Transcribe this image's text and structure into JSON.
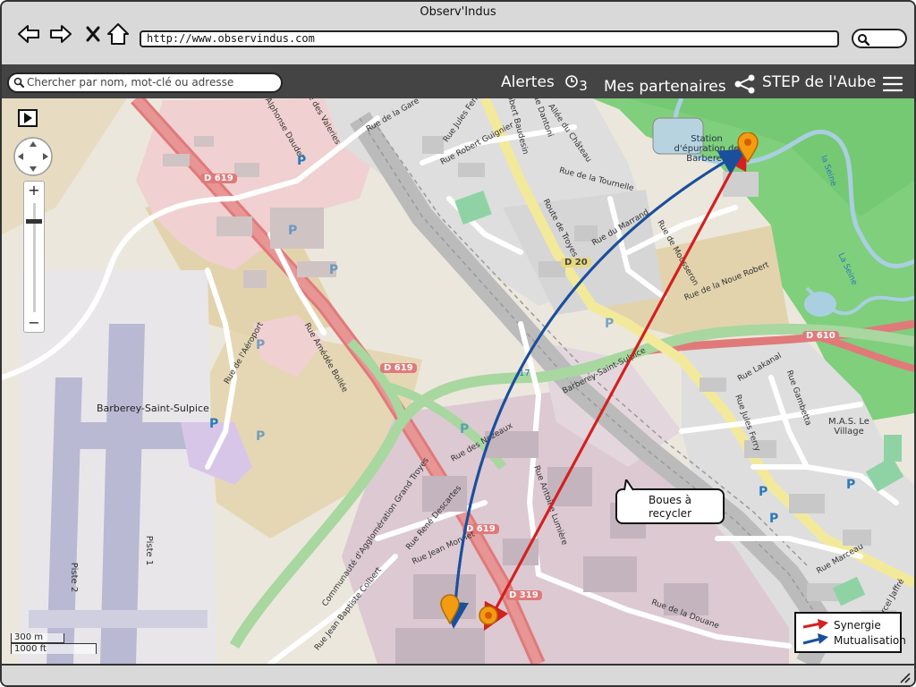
{
  "window": {
    "title": "Observ'Indus"
  },
  "browser": {
    "url": "http://www.observindus.com"
  },
  "appbar": {
    "search_placeholder": "Chercher par nom, mot-clé ou adresse",
    "alerts_label": "Alertes",
    "alerts_count": "3",
    "partners_label": "Mes partenaires",
    "step_label": "STEP de l'Aube"
  },
  "map": {
    "callout": {
      "line1": "Boues à",
      "line2": "recycler"
    },
    "legend": [
      {
        "label": "Synergie",
        "color": "#d42020"
      },
      {
        "label": "Mutualisation",
        "color": "#1a4f9c"
      }
    ],
    "zoom_in": "+",
    "zoom_out": "−",
    "scale": {
      "metric": "300 m",
      "imperial": "1000 ft"
    },
    "labels": {
      "station": "Station d'épuration de Barberey",
      "town": "Barberey-Saint-Sulpice",
      "village": "M.A.S. Le Village",
      "d619a": "D 619",
      "d619b": "D 619",
      "d619c": "D 619",
      "d20": "D 20",
      "d610": "D 610",
      "d319": "D 319",
      "r17": "17",
      "piste1": "Piste 1",
      "piste2": "Piste 2",
      "seine1": "la Seine",
      "seine2": "La Seine",
      "r_troyes": "Route de Troyes",
      "r_aeroport": "Rue de l'Aéroport",
      "r_bollee": "Rue Amédée Bollée",
      "r_nozeaux": "Rue des Nozeaux",
      "r_barberey": "Barberey-Saint-Sulpice",
      "r_communaute": "Communauté d'Agglomération Grand Troyes",
      "r_ferry": "Rue Jules Ferry",
      "r_douane": "Rue de la Douane",
      "r_marceau": "Rue Marceau",
      "r_lakanal": "Rue Lakanal",
      "r_gambetta": "Rue Gambetta",
      "r_marrand": "Rue du Marrand",
      "r_mousseron": "Rue de Mousseron",
      "r_noue": "Rue de la Noue Robert",
      "r_tournelle": "Rue de la Tournelle",
      "r_chateau": "Allée du Château",
      "r_dantoni": "Rue Dantoni",
      "r_guignier": "Rue Robert Guignier",
      "r_jferry": "Rue Jules Ferry",
      "r_gare": "Rue de la Gare",
      "r_valeries": "Rue des Valeries",
      "r_daudet": "Rue Alphonse Daudet",
      "r_baudesin": "Rue Robert Baudesin",
      "r_descartes": "Rue René Descartes",
      "r_monnet": "Rue Jean Monnet",
      "r_colbert": "Rue Jean Baptiste Colbert",
      "r_lumiere": "Rue Antoine Lumière",
      "r_jaffre": "Rue Marcel Jaffré"
    }
  }
}
